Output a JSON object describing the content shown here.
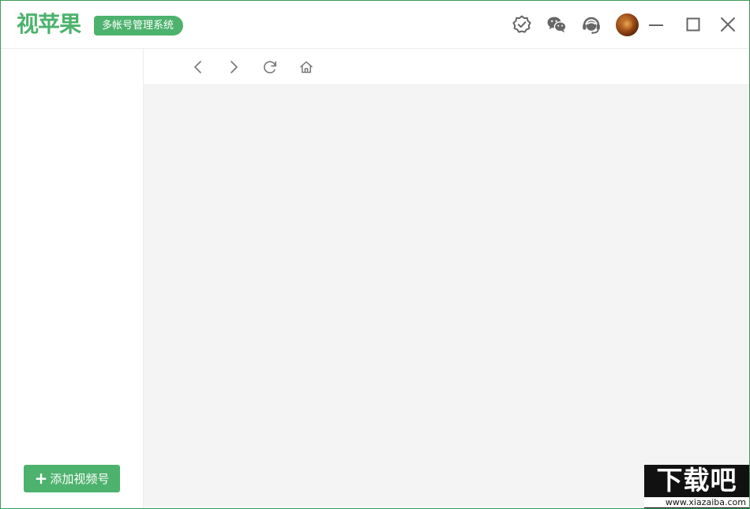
{
  "app": {
    "logo_text": "视苹果",
    "subtitle": "多帐号管理系统"
  },
  "titlebar": {
    "icons": [
      "verified-badge-icon",
      "wechat-icon",
      "customer-service-icon",
      "avatar",
      "minimize-icon",
      "maximize-icon",
      "close-icon"
    ]
  },
  "navbar": {
    "icons": [
      "back-icon",
      "forward-icon",
      "refresh-icon",
      "home-icon"
    ]
  },
  "sidebar": {
    "add_button_icon": "+",
    "add_button_label": "添加视频号"
  },
  "watermark": {
    "main": "下载吧",
    "url": "www.xiazaiba.com"
  },
  "colors": {
    "accent": "#4db26d",
    "border": "#3f9b5b",
    "content_bg": "#f4f4f4",
    "icon_gray": "#666666"
  }
}
